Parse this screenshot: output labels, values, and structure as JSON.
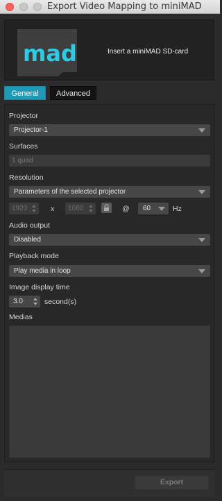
{
  "window": {
    "title": "Export Video Mapping to miniMAD"
  },
  "header": {
    "logo_text": "mad",
    "instruction": "Insert a miniMAD SD-card"
  },
  "tabs": [
    {
      "label": "General",
      "active": true
    },
    {
      "label": "Advanced",
      "active": false
    }
  ],
  "settings": {
    "projector": {
      "label": "Projector",
      "value": "Projector-1"
    },
    "surfaces": {
      "label": "Surfaces",
      "value": "1 quad"
    },
    "resolution": {
      "label": "Resolution",
      "mode": "Parameters of the selected projector",
      "width": "1920",
      "times": "x",
      "height": "1080",
      "at": "@",
      "rate": "60",
      "rate_unit": "Hz"
    },
    "audio": {
      "label": "Audio output",
      "value": "Disabled"
    },
    "playback": {
      "label": "Playback mode",
      "value": "Play media in loop"
    },
    "display_time": {
      "label": "Image display time",
      "value": "3.0",
      "unit": "second(s)"
    },
    "medias": {
      "label": "Medias"
    }
  },
  "footer": {
    "export_label": "Export"
  },
  "colors": {
    "accent": "#1f9ab6",
    "logo": "#2ecbe6",
    "background": "#2b2b2b"
  }
}
